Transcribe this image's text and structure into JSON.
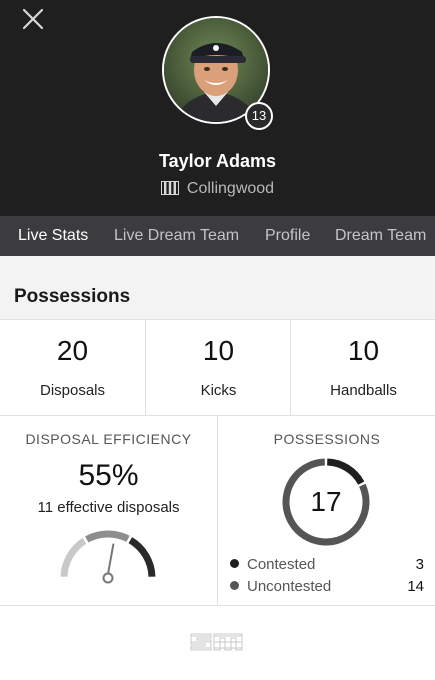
{
  "player": {
    "name": "Taylor Adams",
    "club": "Collingwood",
    "number": "13"
  },
  "tabs": [
    {
      "label": "Live Stats",
      "active": true
    },
    {
      "label": "Live Dream Team",
      "active": false
    },
    {
      "label": "Profile",
      "active": false
    },
    {
      "label": "Dream Team",
      "active": false
    }
  ],
  "section_title": "Possessions",
  "stats": [
    {
      "value": "20",
      "label": "Disposals"
    },
    {
      "value": "10",
      "label": "Kicks"
    },
    {
      "value": "10",
      "label": "Handballs"
    }
  ],
  "efficiency": {
    "title": "DISPOSAL EFFICIENCY",
    "value": "55%",
    "fraction": 0.55,
    "subtitle": "11 effective disposals"
  },
  "possessions": {
    "title": "POSSESSIONS",
    "total": "17",
    "items": [
      {
        "label": "Contested",
        "value": "3",
        "color": "#1f1f1f"
      },
      {
        "label": "Uncontested",
        "value": "14",
        "color": "#555555"
      }
    ]
  },
  "icons": {
    "close": "close-icon",
    "club": "collingwood-stripes-icon",
    "logo": "sm-logo"
  },
  "colors": {
    "header_bg": "#1f1f20",
    "tab_bar_bg": "#3c3c3e",
    "page_bg": "#f3f3f4"
  }
}
